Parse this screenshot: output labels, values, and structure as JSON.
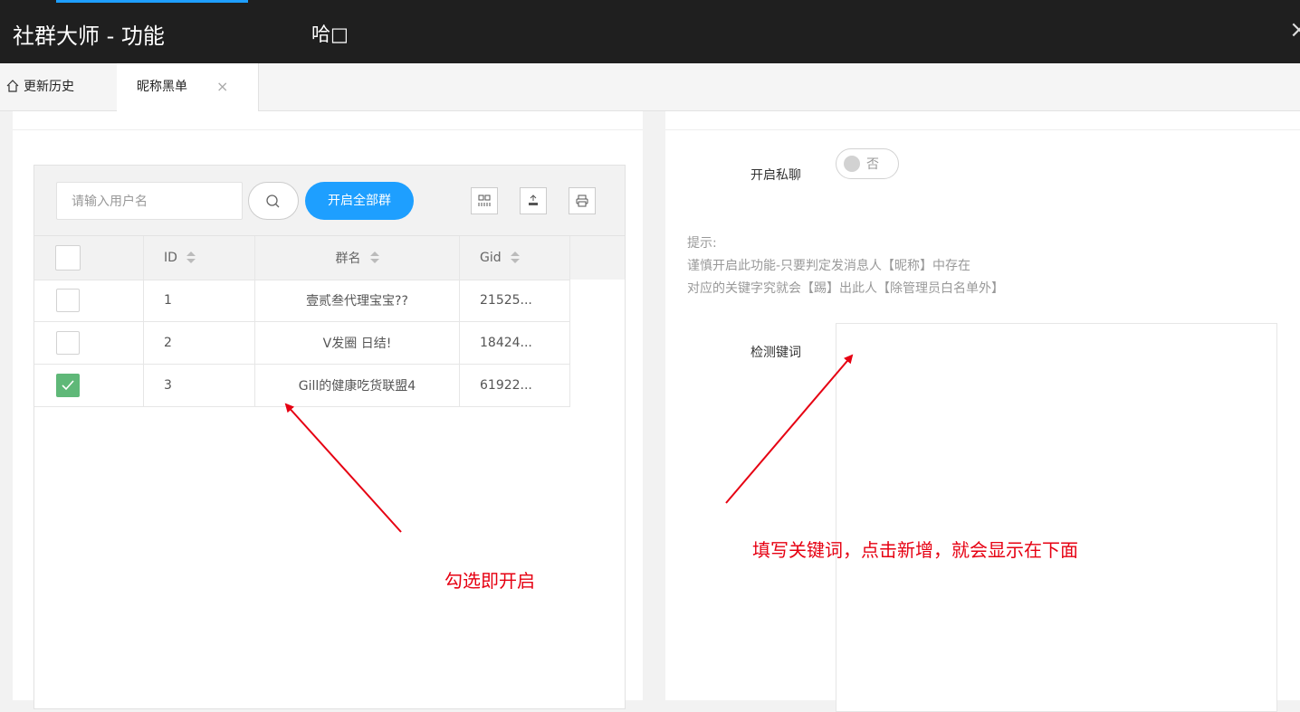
{
  "titlebar": {
    "app_title": "社群大师 - 功能",
    "window_text": "哈□",
    "close_glyph": "×"
  },
  "tabs": {
    "home_label": "更新历史",
    "active_label": "昵称黑单",
    "active_close": "×"
  },
  "table_toolbar": {
    "search_placeholder": "请输入用户名",
    "open_all_label": "开启全部群",
    "tool_icons": [
      "columns-icon",
      "export-icon",
      "print-icon"
    ]
  },
  "table": {
    "columns": [
      "ID",
      "群名",
      "Gid"
    ],
    "rows": [
      {
        "id": "1",
        "name": "壹贰叁代理宝宝??",
        "gid": "21525...",
        "checked": false
      },
      {
        "id": "2",
        "name": "V发圈 日结!",
        "gid": "18424...",
        "checked": false
      },
      {
        "id": "3",
        "name": "Gill的健康吃货联盟4",
        "gid": "61922...",
        "checked": true
      }
    ]
  },
  "settings": {
    "private_chat_label": "开启私聊",
    "private_chat_value": "否",
    "tips": [
      "提示:",
      "谨慎开启此功能-只要判定发消息人【昵称】中存在",
      "对应的关键字究就会【踢】出此人【除管理员白名单外】"
    ],
    "keywords_label": "检测键词",
    "keywords_value": ""
  },
  "annotations": {
    "left_note": "勾选即开启",
    "right_note": "填写关键词，点击新增，就会显示在下面"
  },
  "colors": {
    "accent_blue": "#1e9fff",
    "check_green": "#5fb878",
    "annotation_red": "#e60012",
    "titlebar_bg": "#1f1f1f"
  }
}
